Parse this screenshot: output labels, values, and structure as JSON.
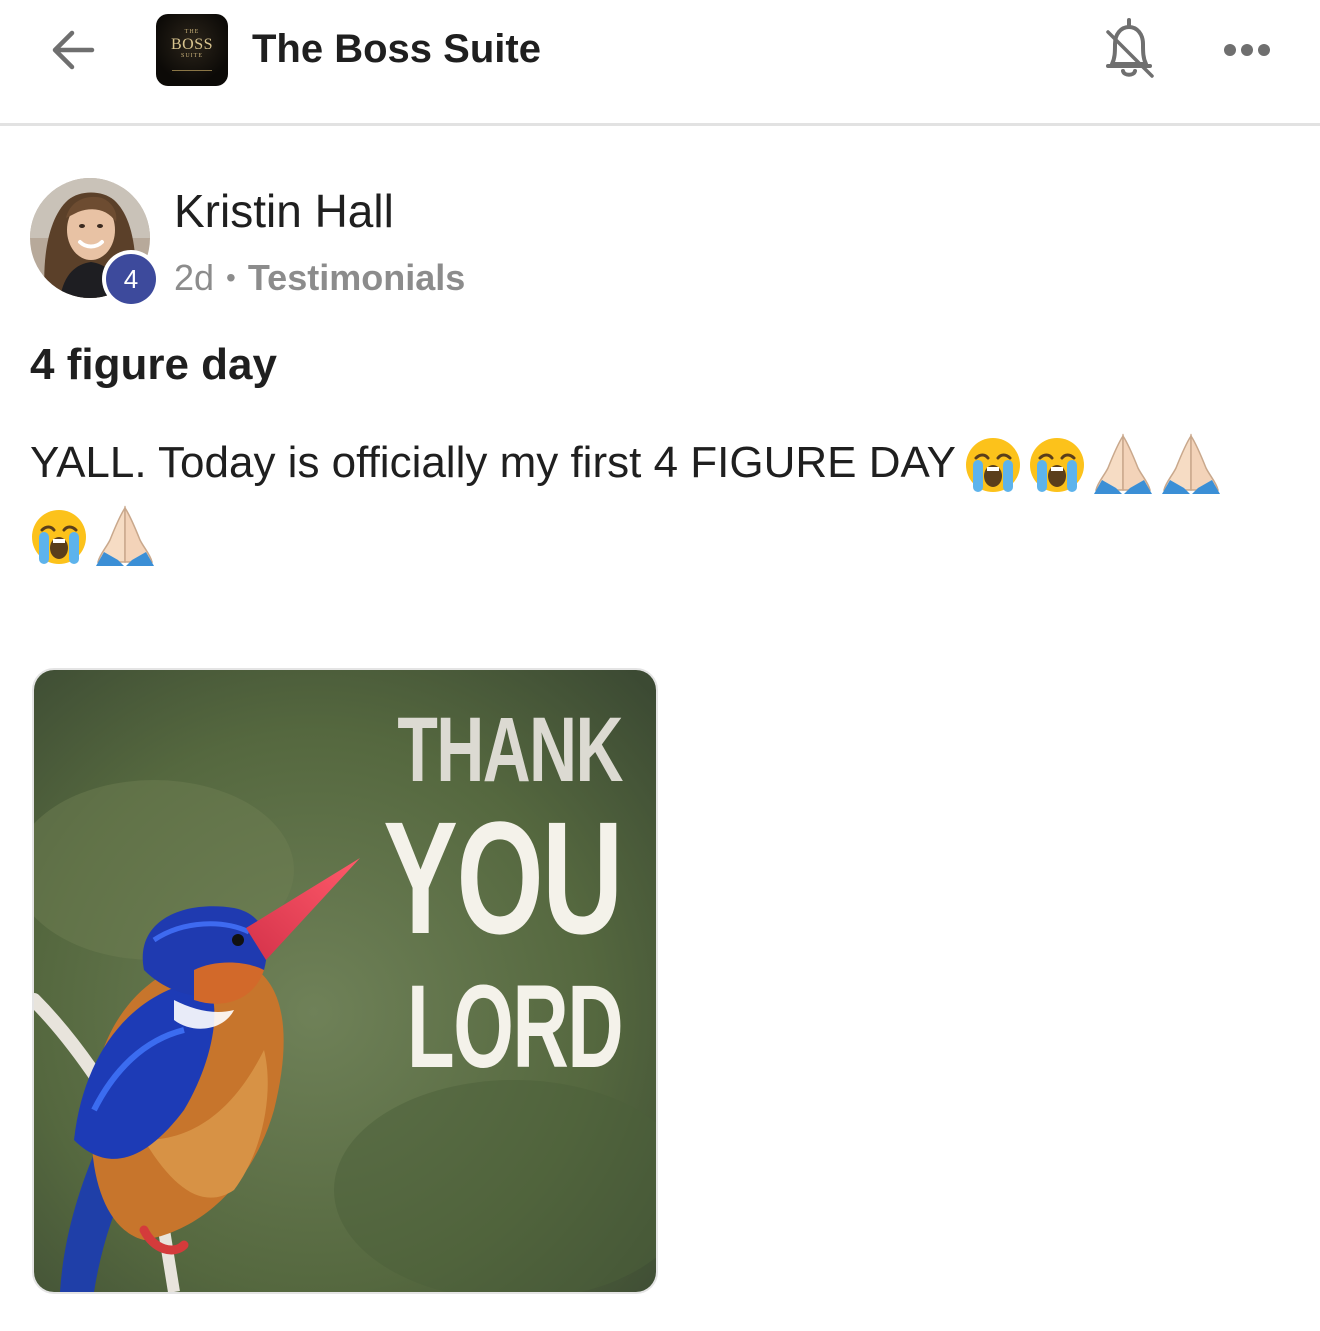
{
  "header": {
    "group_title": "The Boss Suite",
    "logo": {
      "small_top": "THE",
      "main": "BOSS",
      "small_bottom": "SUITE"
    },
    "icons": {
      "back": "arrow-left-icon",
      "notifications": "bell-off-icon",
      "more": "more-horizontal-icon"
    }
  },
  "post": {
    "author": {
      "name": "Kristin Hall",
      "level": "4"
    },
    "time_ago": "2d",
    "separator": "•",
    "category": "Testimonials",
    "title": "4 figure day",
    "body_text": "YALL. Today is officially my first 4 FIGURE DAY",
    "emojis_line1": [
      "crying-face-emoji",
      "crying-face-emoji",
      "folded-hands-emoji",
      "folded-hands-emoji"
    ],
    "emojis_line2": [
      "crying-face-emoji",
      "folded-hands-emoji"
    ],
    "media": {
      "type": "gif",
      "caption_lines": [
        "THANK",
        "YOU",
        "LORD"
      ]
    }
  },
  "colors": {
    "level_badge": "#3d4a9c",
    "divider": "#e2e2e2",
    "muted_text": "#8c8c8c",
    "gif_background": "#56694a"
  }
}
